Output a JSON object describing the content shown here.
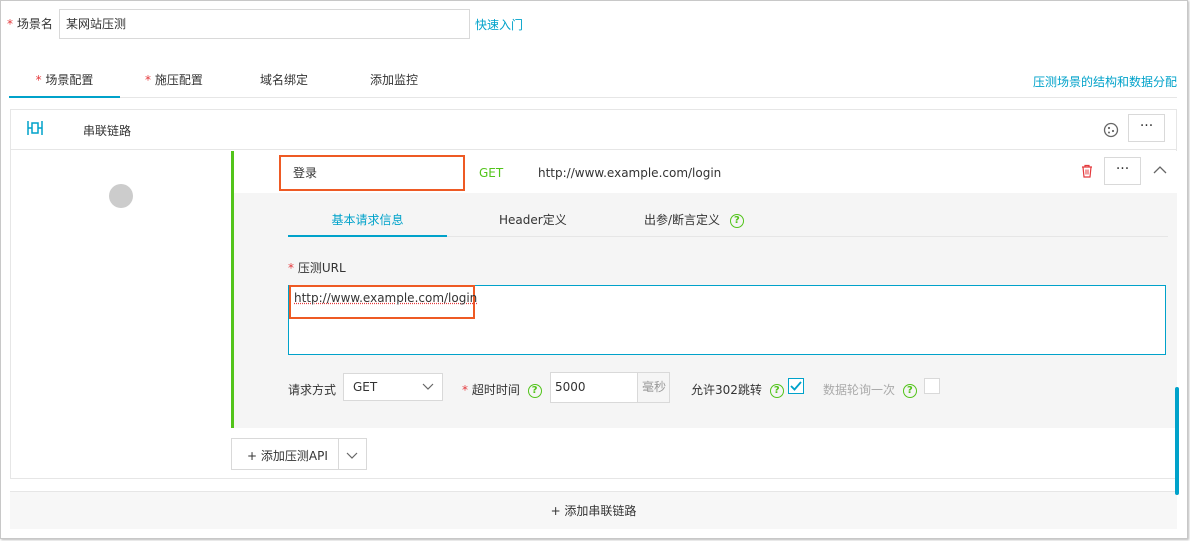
{
  "scene": {
    "label": "场景名",
    "value": "某网站压测",
    "quick_start": "快速入门"
  },
  "tabs": [
    {
      "label": "场景配置",
      "required": true,
      "active": true
    },
    {
      "label": "施压配置",
      "required": true,
      "active": false
    },
    {
      "label": "域名绑定",
      "required": false,
      "active": false
    },
    {
      "label": "添加监控",
      "required": false,
      "active": false
    }
  ],
  "right_link": "压测场景的结构和数据分配",
  "chain": {
    "label": "串联链路",
    "more": "···"
  },
  "api": {
    "name": "登录",
    "method": "GET",
    "url": "http://www.example.com/login",
    "more": "···"
  },
  "inner_tabs": [
    "基本请求信息",
    "Header定义",
    "出参/断言定义"
  ],
  "form": {
    "url_label": "压测URL",
    "url_value": "http://www.example.com/login",
    "method_label": "请求方式",
    "method_value": "GET",
    "timeout_label": "超时时间",
    "timeout_value": "5000",
    "timeout_unit": "毫秒",
    "redirect_label": "允许302跳转",
    "redirect_checked": true,
    "poll_label": "数据轮询一次",
    "poll_checked": false,
    "help": "?"
  },
  "add_api": "+ 添加压测API",
  "add_chain": "+ 添加串联链路",
  "colors": {
    "accent": "#00a2ca",
    "required": "#e4393c",
    "green": "#52c41a",
    "highlight": "#ee5a24"
  }
}
